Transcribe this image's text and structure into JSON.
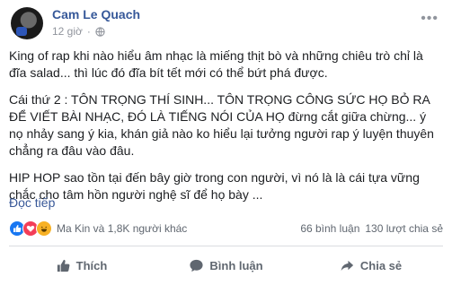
{
  "post": {
    "author": "Cam Le Quach",
    "time": "12 giờ",
    "paragraphs": [
      "King of rap khi nào hiểu âm nhạc là miếng thịt bò và những chiêu trò chỉ là đĩa salad... thì lúc đó đĩa bít tết mới có thể bứt phá được.",
      "Cái thứ 2 : TÔN TRỌNG THÍ SINH... TÔN TRỌNG CÔNG SỨC HỌ BỎ RA ĐỂ VIẾT BÀI NHẠC, ĐÓ LÀ TIẾNG NÓI CỦA HỌ đừng cắt giữa chừng... ý nọ nhảy sang ý kia, khán giả nào ko hiểu lại tưởng người rap ý luyện thuyên chẳng ra đâu vào đâu.",
      "HIP HOP sao tồn tại đến bây giờ trong con người, vì nó là là cái tựa vững chắc cho tâm hồn người nghệ sĩ để họ bày ..."
    ],
    "see_more": "Đọc tiếp"
  },
  "reactions": {
    "icons": [
      "like-icon",
      "love-icon",
      "haha-icon"
    ],
    "summary": "Ma Kin và 1,8K người khác",
    "comments": "66 bình luận",
    "shares": "130 lượt chia sẻ"
  },
  "actions": {
    "like": "Thích",
    "comment": "Bình luận",
    "share": "Chia sẻ"
  },
  "colors": {
    "author": "#365899",
    "link": "#385898",
    "muted": "#90949c",
    "like_blue": "#1877f2",
    "love_red": "#f33e58",
    "haha_yellow": "#f7b125"
  }
}
